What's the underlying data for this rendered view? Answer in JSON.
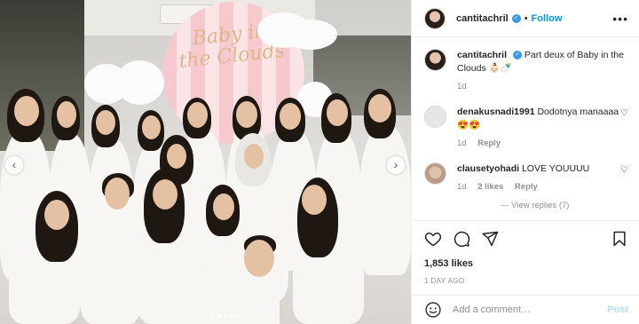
{
  "post": {
    "image_alt": "",
    "board_text": "Baby in the Clouds",
    "carousel": {
      "slide_count": 5,
      "active_index": 1
    }
  },
  "header": {
    "username": "cantitachril",
    "separator": "•",
    "follow_label": "Follow",
    "more_label": "•••"
  },
  "caption": {
    "username": "cantitachril",
    "text": "Part deux of Baby in the Clouds 👶🏻🍼",
    "time": "1d"
  },
  "comments": [
    {
      "username": "denakusnadi1991",
      "text": "Dodotnya manaaaa😍😍",
      "time": "1d",
      "reply_label": "Reply"
    },
    {
      "username": "clausetyohadi",
      "text": "LOVE YOUUUU",
      "time": "1d",
      "likes": "2 likes",
      "reply_label": "Reply"
    }
  ],
  "view_replies": "— View replies (7)",
  "likes": "1,853 likes",
  "date": "1 DAY AGO",
  "add_comment": {
    "placeholder": "Add a comment…",
    "post_label": "Post"
  },
  "icons": {
    "like": "heart-icon",
    "comment": "comment-icon",
    "share": "share-icon",
    "save": "bookmark-icon",
    "emoji": "emoji-icon",
    "prev": "chevron-left-icon",
    "next": "chevron-right-icon"
  },
  "colors": {
    "link_blue": "#0095f6",
    "verified_blue": "#3897f0",
    "post_disabled": "#b2dffc",
    "muted": "#8e8e8e"
  }
}
